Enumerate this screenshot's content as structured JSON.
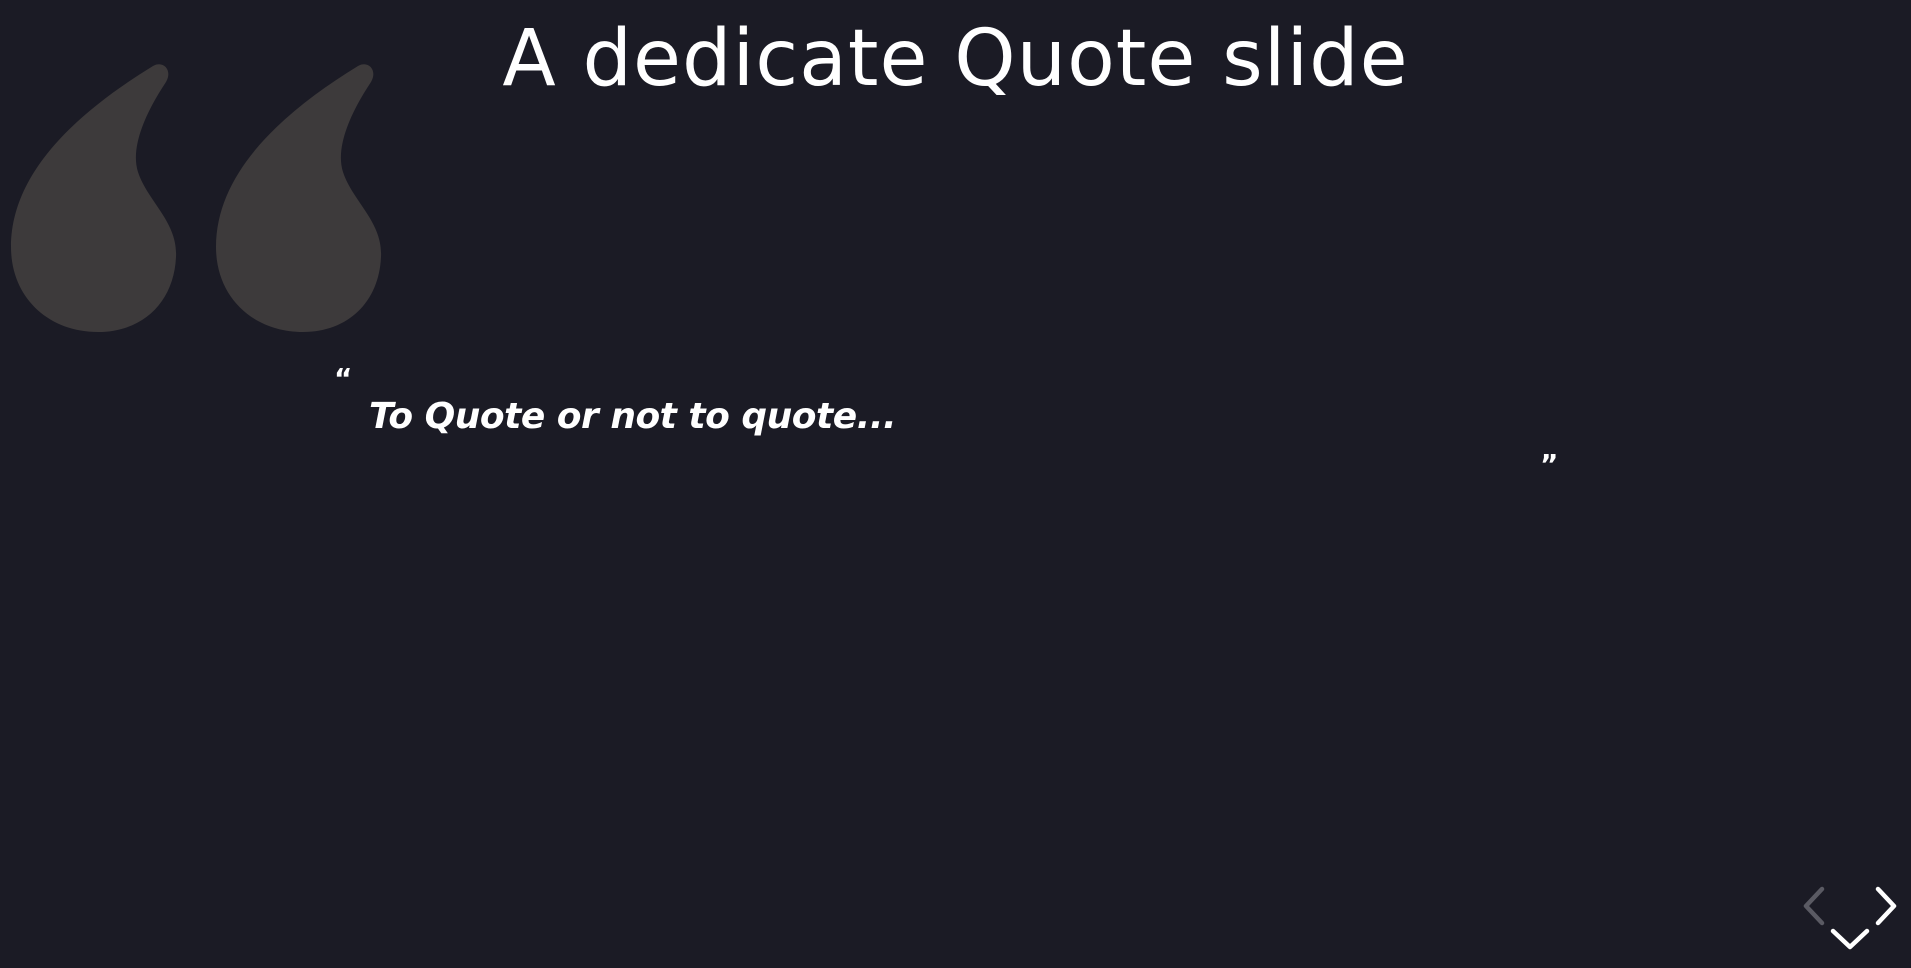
{
  "slide": {
    "title": "A dedicate Quote slide",
    "open_quote": "“",
    "quote_text": "To Quote or not to quote...",
    "close_quote": "”"
  },
  "decoration": {
    "icon": "large-quote-mark-icon",
    "color": "#3d3a3b"
  },
  "controls": {
    "prev": {
      "icon": "chevron-left-icon",
      "enabled": false
    },
    "next": {
      "icon": "chevron-right-icon",
      "enabled": true
    },
    "down": {
      "icon": "chevron-down-icon",
      "enabled": true
    }
  },
  "colors": {
    "background": "#1b1b25",
    "text": "#ffffff"
  }
}
